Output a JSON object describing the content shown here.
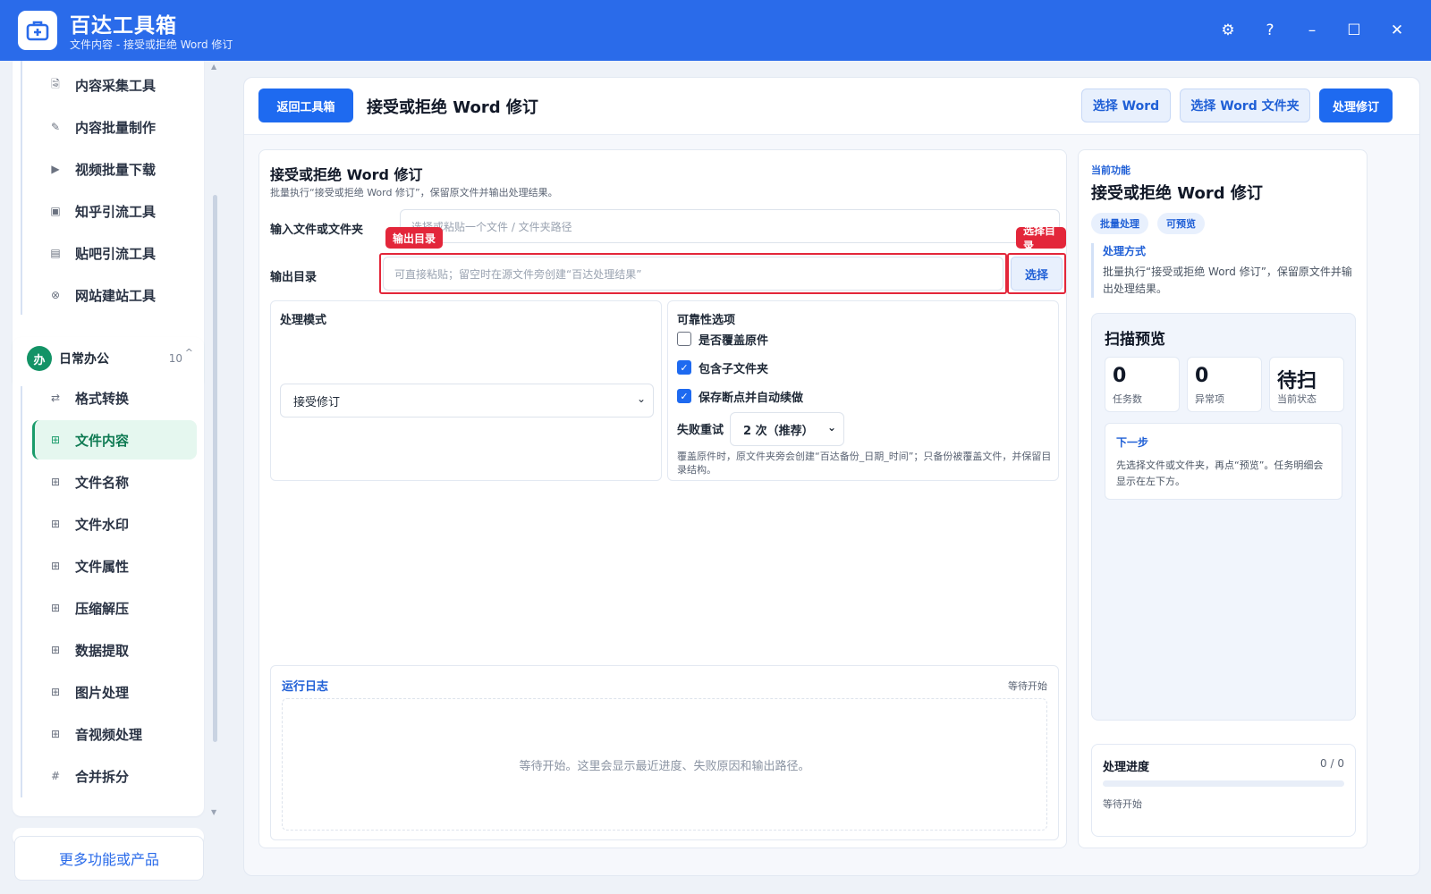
{
  "titlebar": {
    "app_name": "百达工具箱",
    "subtitle": "文件内容 - 接受或拒绝 Word 修订",
    "buttons": [
      "settings-icon",
      "help-icon",
      "minimize-icon",
      "maximize-icon",
      "close-icon"
    ],
    "settings_glyph": "⚙",
    "help_glyph": "?",
    "minimize_glyph": "–",
    "maximize_glyph": "☐",
    "close_glyph": "✕"
  },
  "sidebar": {
    "top_items": [
      {
        "label": "内容采集工具",
        "icon": "🗟"
      },
      {
        "label": "内容批量制作",
        "icon": "✎"
      },
      {
        "label": "视频批量下载",
        "icon": "▶"
      },
      {
        "label": "知乎引流工具",
        "icon": "▣"
      },
      {
        "label": "贴吧引流工具",
        "icon": "▤"
      },
      {
        "label": "网站建站工具",
        "icon": "⊗"
      }
    ],
    "group": {
      "badge": "办",
      "title": "日常办公",
      "count": "10",
      "caret": "^"
    },
    "group_items": [
      {
        "label": "格式转换",
        "icon": "⇄"
      },
      {
        "label": "文件内容",
        "icon": "⊞",
        "active": true
      },
      {
        "label": "文件名称",
        "icon": "⊞"
      },
      {
        "label": "文件水印",
        "icon": "⊞"
      },
      {
        "label": "文件属性",
        "icon": "⊞"
      },
      {
        "label": "压缩解压",
        "icon": "⊞"
      },
      {
        "label": "数据提取",
        "icon": "⊞"
      },
      {
        "label": "图片处理",
        "icon": "⊞"
      },
      {
        "label": "音视频处理",
        "icon": "⊞"
      },
      {
        "label": "合并拆分",
        "icon": "#"
      }
    ],
    "more_label": "更多功能或产品"
  },
  "toolbar": {
    "back_label": "返回工具箱",
    "title": "接受或拒绝 Word 修订",
    "select_word_label": "选择 Word",
    "select_folder_label": "选择 Word 文件夹",
    "process_label": "处理修订"
  },
  "form": {
    "title": "接受或拒绝 Word 修订",
    "subtitle": "批量执行“接受或拒绝 Word 修订”，保留原文件并输出处理结果。",
    "input_label": "输入文件或文件夹",
    "input_placeholder": "选择或粘贴一个文件 / 文件夹路径",
    "output_label": "输出目录",
    "output_placeholder": "可直接粘贴；留空时在源文件旁创建“百达处理结果”",
    "output_tag": "输出目录",
    "select_dir_tag": "选择目录",
    "select_button": "选择",
    "mode": {
      "title": "处理模式",
      "selected": "接受修订"
    },
    "reliability": {
      "title": "可靠性选项",
      "overwrite": {
        "label": "是否覆盖原件",
        "checked": false
      },
      "include_sub": {
        "label": "包含子文件夹",
        "checked": true
      },
      "resume": {
        "label": "保存断点并自动续做",
        "checked": true
      },
      "retry_label": "失败重试",
      "retry_value": "2 次（推荐）",
      "hint": "覆盖原件时，原文件夹旁会创建“百达备份_日期_时间”；只备份被覆盖文件，并保留目录结构。"
    }
  },
  "log": {
    "title": "运行日志",
    "status": "等待开始",
    "placeholder": "等待开始。这里会显示最近进度、失败原因和输出路径。"
  },
  "info": {
    "label": "当前功能",
    "title": "接受或拒绝 Word 修订",
    "chips": [
      "批量处理",
      "可预览"
    ],
    "method_title": "处理方式",
    "method_text": "批量执行“接受或拒绝 Word 修订”，保留原文件并输出处理结果。",
    "scan": {
      "title": "扫描预览",
      "stats": [
        {
          "num": "0",
          "cap": "任务数"
        },
        {
          "num": "0",
          "cap": "异常项"
        },
        {
          "num": "待扫",
          "cap": "当前状态"
        }
      ],
      "next_title": "下一步",
      "next_text": "先选择文件或文件夹，再点“预览”。任务明细会显示在左下方。"
    },
    "progress": {
      "title": "处理进度",
      "count": "0 / 0",
      "fraction": 0,
      "status": "等待开始"
    }
  }
}
